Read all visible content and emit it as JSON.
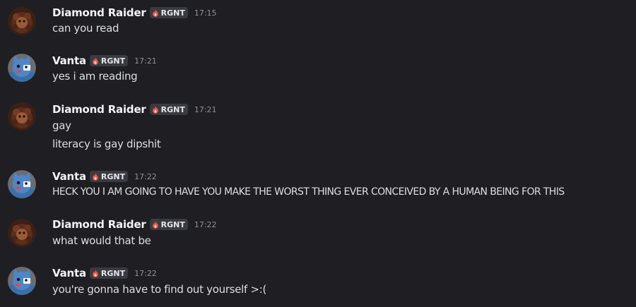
{
  "tag_label": "RGNT",
  "colors": {
    "background": "#1f1f23",
    "username": "#f2f3f5",
    "message": "#dbdee1",
    "timestamp": "#8e9197",
    "tag_bg": "#3a3b41",
    "tag_icon": "#ef5a4c"
  },
  "messages": [
    {
      "author": "Diamond Raider",
      "avatar": "diamond-raider-avatar",
      "time": "17:15",
      "lines": [
        "can you read"
      ]
    },
    {
      "author": "Vanta",
      "avatar": "vanta-avatar",
      "time": "17:21",
      "lines": [
        "yes i am reading"
      ]
    },
    {
      "author": "Diamond Raider",
      "avatar": "diamond-raider-avatar",
      "time": "17:21",
      "lines": [
        "gay",
        "literacy is gay dipshit"
      ]
    },
    {
      "author": "Vanta",
      "avatar": "vanta-avatar",
      "time": "17:22",
      "lines": [
        "HECK YOU I AM GOING TO HAVE YOU MAKE THE WORST THING EVER CONCEIVED BY A HUMAN BEING FOR THIS"
      ]
    },
    {
      "author": "Diamond Raider",
      "avatar": "diamond-raider-avatar",
      "time": "17:22",
      "lines": [
        "what would that be"
      ]
    },
    {
      "author": "Vanta",
      "avatar": "vanta-avatar",
      "time": "17:22",
      "lines": [
        "you're gonna have to find out yourself >:("
      ]
    }
  ]
}
